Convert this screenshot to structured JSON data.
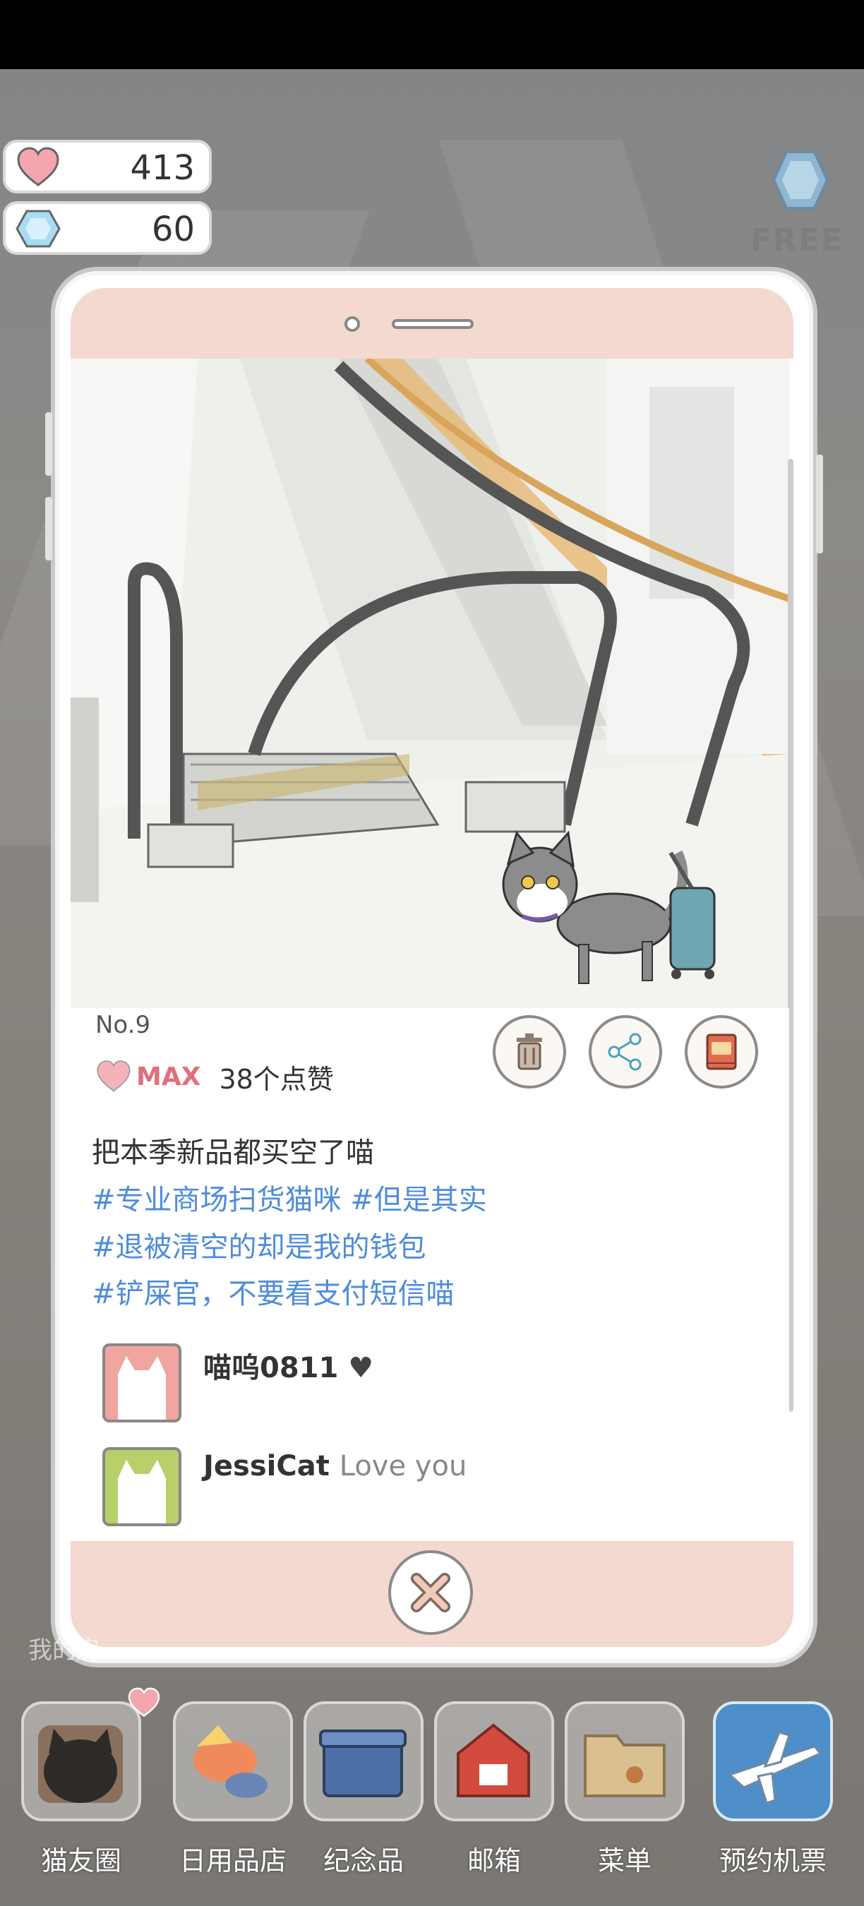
{
  "resources": {
    "hearts": "413",
    "gems": "60",
    "free_label": "FREE"
  },
  "post": {
    "number": "No.9",
    "max_label": "MAX",
    "likes": "38个点赞",
    "caption": "把本季新品都买空了喵",
    "tags": [
      "#专业商场扫货猫咪 #但是其实",
      "#退被清空的却是我的钱包",
      "#铲屎官，不要看支付短信喵"
    ],
    "comments": [
      {
        "user": "喵呜0811",
        "text": "♥",
        "avatar_color": "#f0a5a0"
      },
      {
        "user": "JessiCat",
        "text": "Love you",
        "avatar_color": "#b8cf6a"
      }
    ]
  },
  "icons": {
    "delete": "trash-icon",
    "share": "share-icon",
    "album": "album-icon",
    "close": "close-icon"
  },
  "background_label": "我的房",
  "nav": [
    {
      "label": "猫友圈",
      "icon": "cat-friends-icon"
    },
    {
      "label": "日用品店",
      "icon": "shop-icon"
    },
    {
      "label": "纪念品",
      "icon": "souvenir-box-icon"
    },
    {
      "label": "邮箱",
      "icon": "mailbox-icon"
    },
    {
      "label": "菜单",
      "icon": "menu-folder-icon"
    },
    {
      "label": "预约机票",
      "icon": "airplane-icon"
    }
  ],
  "colors": {
    "accent_pink": "#e0707d",
    "tag_blue": "#4f8cd9",
    "phone_bar": "#f3d9cf"
  }
}
